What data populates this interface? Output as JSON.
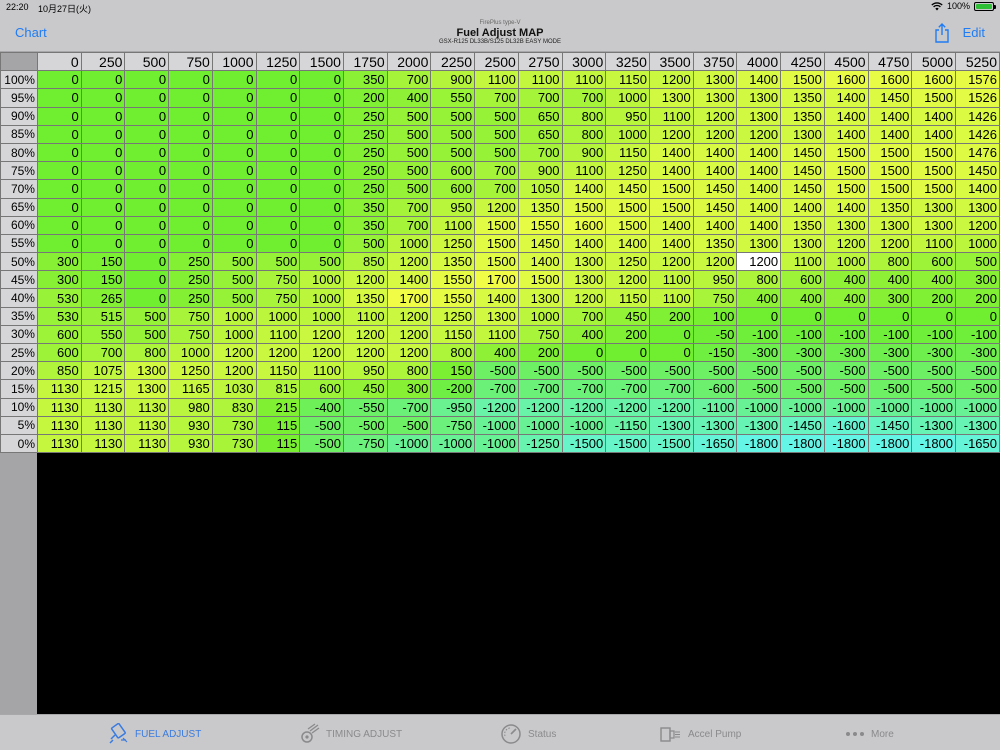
{
  "status": {
    "time": "22:20",
    "date": "10月27日(火)",
    "battery": "100%"
  },
  "nav": {
    "left_button": "Chart",
    "right_button": "Edit",
    "subtitle": "FirePlus type-V",
    "title": "Fuel Adjust MAP",
    "model": "GSX-R125 DL33B/S125 DL32B EASY MODE"
  },
  "table": {
    "columns": [
      "0",
      "250",
      "500",
      "750",
      "1000",
      "1250",
      "1500",
      "1750",
      "2000",
      "2250",
      "2500",
      "2750",
      "3000",
      "3250",
      "3500",
      "3750",
      "4000",
      "4250",
      "4500",
      "4750",
      "5000",
      "5250"
    ],
    "selected": {
      "row": 10,
      "col": 16
    },
    "rows": [
      {
        "label": "100%",
        "values": [
          0,
          0,
          0,
          0,
          0,
          0,
          0,
          350,
          700,
          900,
          1100,
          1100,
          1100,
          1150,
          1200,
          1300,
          1400,
          1500,
          1600,
          1600,
          1600,
          1576
        ]
      },
      {
        "label": "95%",
        "values": [
          0,
          0,
          0,
          0,
          0,
          0,
          0,
          200,
          400,
          550,
          700,
          700,
          700,
          1000,
          1300,
          1300,
          1300,
          1350,
          1400,
          1450,
          1500,
          1526
        ]
      },
      {
        "label": "90%",
        "values": [
          0,
          0,
          0,
          0,
          0,
          0,
          0,
          250,
          500,
          500,
          500,
          650,
          800,
          950,
          1100,
          1200,
          1300,
          1350,
          1400,
          1400,
          1400,
          1426
        ]
      },
      {
        "label": "85%",
        "values": [
          0,
          0,
          0,
          0,
          0,
          0,
          0,
          250,
          500,
          500,
          500,
          650,
          800,
          1000,
          1200,
          1200,
          1200,
          1300,
          1400,
          1400,
          1400,
          1426
        ]
      },
      {
        "label": "80%",
        "values": [
          0,
          0,
          0,
          0,
          0,
          0,
          0,
          250,
          500,
          500,
          500,
          700,
          900,
          1150,
          1400,
          1400,
          1400,
          1450,
          1500,
          1500,
          1500,
          1476
        ]
      },
      {
        "label": "75%",
        "values": [
          0,
          0,
          0,
          0,
          0,
          0,
          0,
          250,
          500,
          600,
          700,
          900,
          1100,
          1250,
          1400,
          1400,
          1400,
          1450,
          1500,
          1500,
          1500,
          1450
        ]
      },
      {
        "label": "70%",
        "values": [
          0,
          0,
          0,
          0,
          0,
          0,
          0,
          250,
          500,
          600,
          700,
          1050,
          1400,
          1450,
          1500,
          1450,
          1400,
          1450,
          1500,
          1500,
          1500,
          1400
        ]
      },
      {
        "label": "65%",
        "values": [
          0,
          0,
          0,
          0,
          0,
          0,
          0,
          350,
          700,
          950,
          1200,
          1350,
          1500,
          1500,
          1500,
          1450,
          1400,
          1400,
          1400,
          1350,
          1300,
          1300
        ]
      },
      {
        "label": "60%",
        "values": [
          0,
          0,
          0,
          0,
          0,
          0,
          0,
          350,
          700,
          1100,
          1500,
          1550,
          1600,
          1500,
          1400,
          1400,
          1400,
          1350,
          1300,
          1300,
          1300,
          1200
        ]
      },
      {
        "label": "55%",
        "values": [
          0,
          0,
          0,
          0,
          0,
          0,
          0,
          500,
          1000,
          1250,
          1500,
          1450,
          1400,
          1400,
          1400,
          1350,
          1300,
          1300,
          1200,
          1200,
          1100,
          1000
        ]
      },
      {
        "label": "50%",
        "values": [
          300,
          150,
          0,
          250,
          500,
          500,
          500,
          850,
          1200,
          1350,
          1500,
          1400,
          1300,
          1250,
          1200,
          1200,
          1200,
          1100,
          1000,
          800,
          600,
          500
        ]
      },
      {
        "label": "45%",
        "values": [
          300,
          150,
          0,
          250,
          500,
          750,
          1000,
          1200,
          1400,
          1550,
          1700,
          1500,
          1300,
          1200,
          1100,
          950,
          800,
          600,
          400,
          400,
          400,
          300
        ]
      },
      {
        "label": "40%",
        "values": [
          530,
          265,
          0,
          250,
          500,
          750,
          1000,
          1350,
          1700,
          1550,
          1400,
          1300,
          1200,
          1150,
          1100,
          750,
          400,
          400,
          400,
          300,
          200,
          200
        ]
      },
      {
        "label": "35%",
        "values": [
          530,
          515,
          500,
          750,
          1000,
          1000,
          1000,
          1100,
          1200,
          1250,
          1300,
          1000,
          700,
          450,
          200,
          100,
          0,
          0,
          0,
          0,
          0,
          0
        ]
      },
      {
        "label": "30%",
        "values": [
          600,
          550,
          500,
          750,
          1000,
          1100,
          1200,
          1200,
          1200,
          1150,
          1100,
          750,
          400,
          200,
          0,
          -50,
          -100,
          -100,
          -100,
          -100,
          -100,
          -100
        ]
      },
      {
        "label": "25%",
        "values": [
          600,
          700,
          800,
          1000,
          1200,
          1200,
          1200,
          1200,
          1200,
          800,
          400,
          200,
          0,
          0,
          0,
          -150,
          -300,
          -300,
          -300,
          -300,
          -300,
          -300
        ]
      },
      {
        "label": "20%",
        "values": [
          850,
          1075,
          1300,
          1250,
          1200,
          1150,
          1100,
          950,
          800,
          150,
          -500,
          -500,
          -500,
          -500,
          -500,
          -500,
          -500,
          -500,
          -500,
          -500,
          -500,
          -500
        ]
      },
      {
        "label": "15%",
        "values": [
          1130,
          1215,
          1300,
          1165,
          1030,
          815,
          600,
          450,
          300,
          -200,
          -700,
          -700,
          -700,
          -700,
          -700,
          -600,
          -500,
          -500,
          -500,
          -500,
          -500,
          -500
        ]
      },
      {
        "label": "10%",
        "values": [
          1130,
          1130,
          1130,
          980,
          830,
          215,
          -400,
          -550,
          -700,
          -950,
          -1200,
          -1200,
          -1200,
          -1200,
          -1200,
          -1100,
          -1000,
          -1000,
          -1000,
          -1000,
          -1000,
          -1000
        ]
      },
      {
        "label": "5%",
        "values": [
          1130,
          1130,
          1130,
          930,
          730,
          115,
          -500,
          -500,
          -500,
          -750,
          -1000,
          -1000,
          -1000,
          -1150,
          -1300,
          -1300,
          -1300,
          -1450,
          -1600,
          -1450,
          -1300,
          -1300
        ]
      },
      {
        "label": "0%",
        "values": [
          1130,
          1130,
          1130,
          930,
          730,
          115,
          -500,
          -750,
          -1000,
          -1000,
          -1000,
          -1250,
          -1500,
          -1500,
          -1500,
          -1650,
          -1800,
          -1800,
          -1800,
          -1800,
          -1800,
          -1650
        ]
      }
    ]
  },
  "tabs": [
    {
      "label": "FUEL ADJUST",
      "icon": "fuel-injector-icon",
      "active": true
    },
    {
      "label": "TIMING ADJUST",
      "icon": "timing-gear-icon",
      "active": false
    },
    {
      "label": "Status",
      "icon": "gauge-icon",
      "active": false
    },
    {
      "label": "Accel Pump",
      "icon": "accel-pump-icon",
      "active": false
    },
    {
      "label": "More",
      "icon": "more-dots-icon",
      "active": false
    }
  ]
}
